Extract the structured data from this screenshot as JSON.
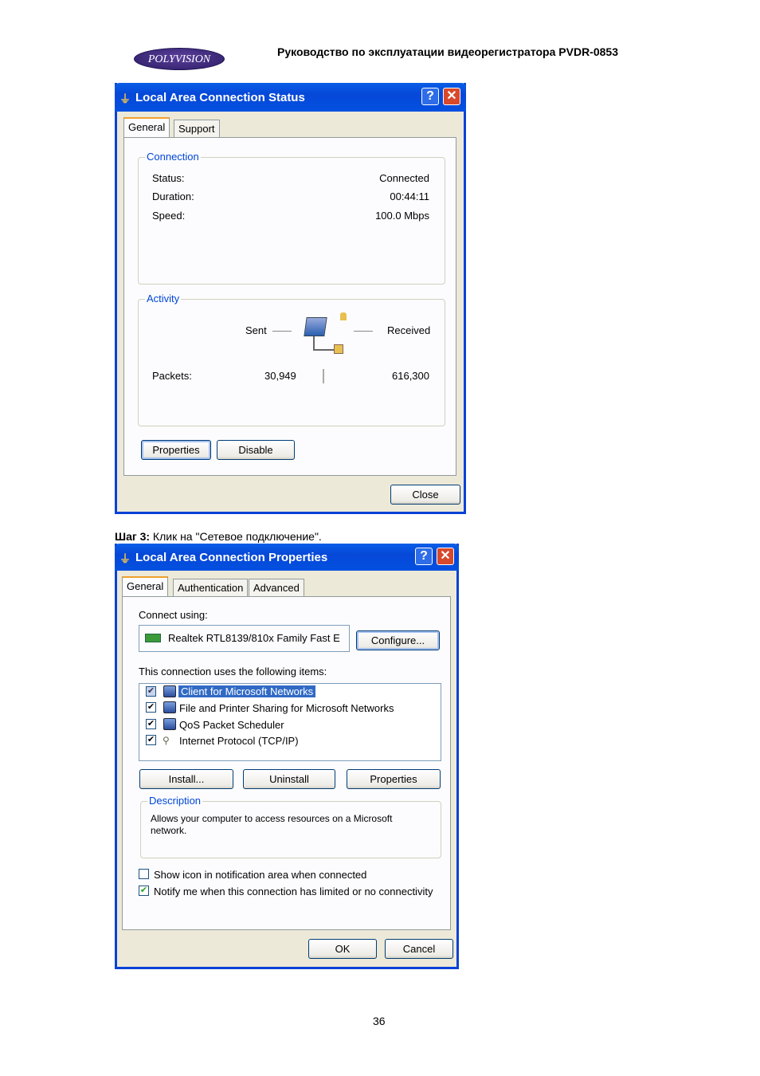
{
  "header": {
    "logo": "POLYVISION",
    "title": "Руководство по эксплуатации видеорегистратора PVDR-0853"
  },
  "status_dialog": {
    "title": "Local Area Connection Status",
    "tabs": [
      "General",
      "Support"
    ],
    "connection": {
      "label": "Connection",
      "rows": [
        {
          "k": "Status:",
          "v": "Connected"
        },
        {
          "k": "Duration:",
          "v": "00:44:11"
        },
        {
          "k": "Speed:",
          "v": "100.0 Mbps"
        }
      ]
    },
    "activity": {
      "label": "Activity",
      "sent": "Sent",
      "received": "Received",
      "packets_label": "Packets:",
      "sent_value": "30,949",
      "received_value": "616,300"
    },
    "buttons": {
      "properties": "Properties",
      "disable": "Disable",
      "close": "Close"
    }
  },
  "caption": {
    "bold": "Шаг 3:",
    "text": " Клик на \"Сетевое подключение\"."
  },
  "properties_dialog": {
    "title": "Local Area Connection Properties",
    "tabs": [
      "General",
      "Authentication",
      "Advanced"
    ],
    "connect_using_label": "Connect using:",
    "adapter": "Realtek RTL8139/810x Family Fast E",
    "configure": "Configure...",
    "items_label": "This connection uses the following items:",
    "items": [
      {
        "label": "Client for Microsoft Networks",
        "checked": true,
        "selected": true,
        "icon": "network-client-icon"
      },
      {
        "label": "File and Printer Sharing for Microsoft Networks",
        "checked": true,
        "icon": "network-service-icon"
      },
      {
        "label": "QoS Packet Scheduler",
        "checked": true,
        "icon": "network-service-icon"
      },
      {
        "label": "Internet Protocol (TCP/IP)",
        "checked": true,
        "icon": "protocol-icon"
      }
    ],
    "buttons": {
      "install": "Install...",
      "uninstall": "Uninstall",
      "properties": "Properties",
      "ok": "OK",
      "cancel": "Cancel"
    },
    "description": {
      "label": "Description",
      "text": "Allows your computer to access resources on a Microsoft network."
    },
    "options": [
      {
        "label": "Show icon in notification area when connected",
        "checked": false
      },
      {
        "label": "Notify me when this connection has limited or no connectivity",
        "checked": true
      }
    ]
  },
  "page_number": "36",
  "colors": {
    "titlebar": "#0a5ee8",
    "dialog_bg": "#ece9d8",
    "group_label": "#0046d5",
    "selection": "#316ac5"
  }
}
